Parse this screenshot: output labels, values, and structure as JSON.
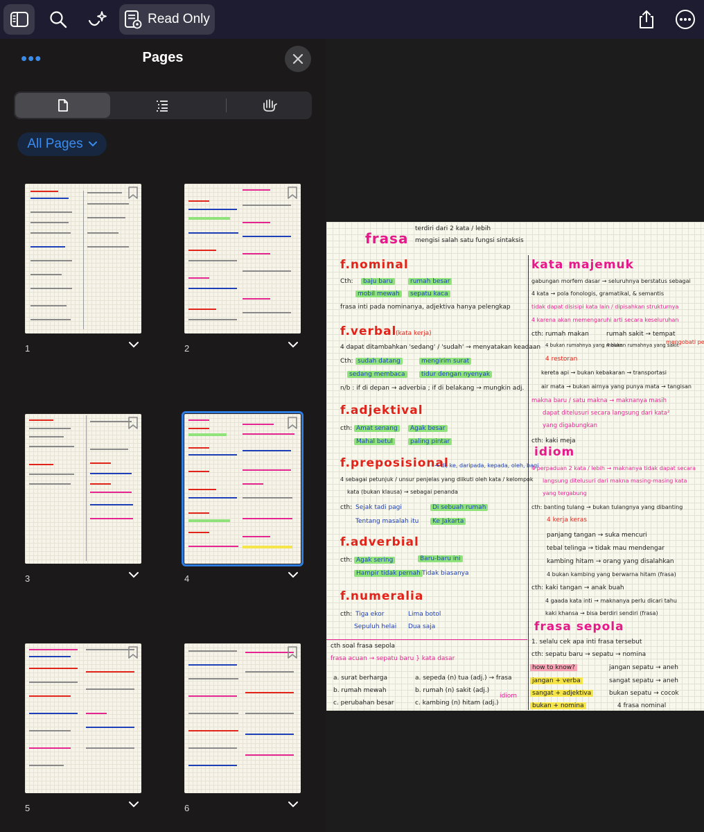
{
  "toolbar": {
    "read_only_label": "Read Only"
  },
  "sidebar": {
    "title": "Pages",
    "more_dots": "•••",
    "filter_label": "All Pages",
    "segments": [
      "page-view",
      "outline-view",
      "bookmark-view"
    ]
  },
  "thumbnails": [
    {
      "number": "1",
      "selected": false
    },
    {
      "number": "2",
      "selected": false
    },
    {
      "number": "3",
      "selected": false
    },
    {
      "number": "4",
      "selected": true
    },
    {
      "number": "5",
      "selected": false
    },
    {
      "number": "6",
      "selected": false
    }
  ],
  "note": {
    "title": "frasa",
    "intro_1": "terdiri dari 2 kata / lebih",
    "intro_2": "mengisi salah satu fungsi sintaksis",
    "left": {
      "nominal": {
        "heading": "f.nominal",
        "cth": "Cth:",
        "ex1": "baju baru",
        "ex2": "rumah besar",
        "ex3": "mobil mewah",
        "ex4": "sepatu kaca",
        "note": "frasa inti pada nominanya, adjektiva hanya pelengkap"
      },
      "verbal": {
        "heading": "f.verbal",
        "sub": "(kata kerja)",
        "note": "4 dapat ditambahkan 'sedang' / 'sudah' → menyatakan keadaan",
        "cth": "Cth:",
        "ex1": "sudah datang",
        "ex2": "mengirim surat",
        "ex3": "sedang membaca",
        "ex4": "tidur dengan nyenyak",
        "rule": "n/b : if di depan → adverbia ; if di belakang → mungkin adj."
      },
      "adjektival": {
        "heading": "f.adjektival",
        "cth": "cth:",
        "ex1": "Amat senang",
        "ex2": "Agak besar",
        "ex3": "Mahal betul",
        "ex4": "paling pintar"
      },
      "preposisional": {
        "heading": "f.preposisional",
        "tail": "→ di, ke, daripada, kepada, oleh, bagi",
        "note": "4 sebagai petunjuk / unsur penjelas yang diikuti oleh kata / kelompok",
        "note2": "kata (bukan klausa) → sebagai penanda",
        "cth": "cth:",
        "ex1": "Sejak tadi pagi",
        "ex2": "Di sebuah rumah",
        "ex3": "Tentang masalah itu",
        "ex4": "Ke Jakarta"
      },
      "adverbial": {
        "heading": "f.adverbial",
        "cth": "cth:",
        "ex1": "Agak sering",
        "ex2": "Baru-baru ini",
        "ex3": "Hampir tidak pernah",
        "ex4": "Tidak biasanya"
      },
      "numeralia": {
        "heading": "f.numeralia",
        "cth": "cth:",
        "ex1": "Tiga ekor",
        "ex2": "Lima botol",
        "ex3": "Sepuluh helai",
        "ex4": "Dua saja"
      },
      "soal": {
        "line1": "cth soal frasa sepola",
        "line2": "frasa acuan → sepatu baru } kata dasar",
        "a": "a. surat berharga",
        "b": "b. rumah mewah",
        "c": "c. perubahan besar",
        "a2": "a. sepeda (n) tua (adj.) → frasa",
        "b2": "b. rumah (n) sakit (adj.)",
        "c2": "c. kambing (n) hitam (adj.)",
        "idiom": "idiom"
      }
    },
    "right": {
      "majemuk": {
        "heading": "kata majemuk",
        "l1": "gabungan morfem dasar → seluruhnya berstatus sebagai",
        "l2": "4 kata → pola fonologis, gramatikal, & semantis",
        "l3": "tidak dapat disisipi kata lain / dipisahkan strukturnya",
        "l4": "4 karena akan memengaruhi arti secara keseluruhan",
        "cth": "cth:",
        "e1": "rumah makan",
        "e2": "rumah sakit → tempat",
        "e3": "4 bukan rumahnya yang makan",
        "e4": "4 bukan rumahnya yang sakit",
        "e5": "mengobati penyakit",
        "e6": "4 restoran",
        "e7": "kereta api → bukan kebakaran → transportasi",
        "e8": "air mata → bukan airnya yang punya mata → tangisan",
        "m1": "makna baru / satu makna → maknanya masih",
        "m2": "dapat ditelusuri secara langsung dari kata²",
        "m3": "yang digabungkan",
        "m4": "cth: kaki meja"
      },
      "idiom": {
        "heading": "idiom",
        "l1": "4 perpaduan 2 kata / lebih → maknanya tidak dapat secara",
        "l2": "langsung ditelusuri dari makna masing-masing kata",
        "l3": "yang tergabung",
        "l4": "cth: banting tulang → bukan tulangnya yang dibanting",
        "l5": "4 kerja keras",
        "l6": "panjang tangan → suka mencuri",
        "l7": "tebal telinga → tidak mau mendengar",
        "l8": "kambing hitam → orang yang disalahkan",
        "l9": "4 bukan kambing yang berwarna hitam (frasa)",
        "l10": "cth: kaki tangan → anak buah",
        "l11": "4 gaada kata inti → maknanya perlu dicari tahu",
        "l12": "kaki khansa → bisa berdiri sendiri (frasa)"
      },
      "sepola": {
        "heading": "frasa sepola",
        "l1": "1. selalu cek apa inti frasa tersebut",
        "l2": "cth: sepatu baru → sepatu → nomina",
        "how": "how to know?",
        "r1": "jangan + verba",
        "r2": "sangat + adjektiva",
        "r3": "bukan + nomina",
        "x1": "jangan sepatu → aneh",
        "x2": "sangat sepatu → aneh",
        "x3": "bukan sepatu → cocok",
        "x4": "4 frasa nominal"
      }
    }
  }
}
